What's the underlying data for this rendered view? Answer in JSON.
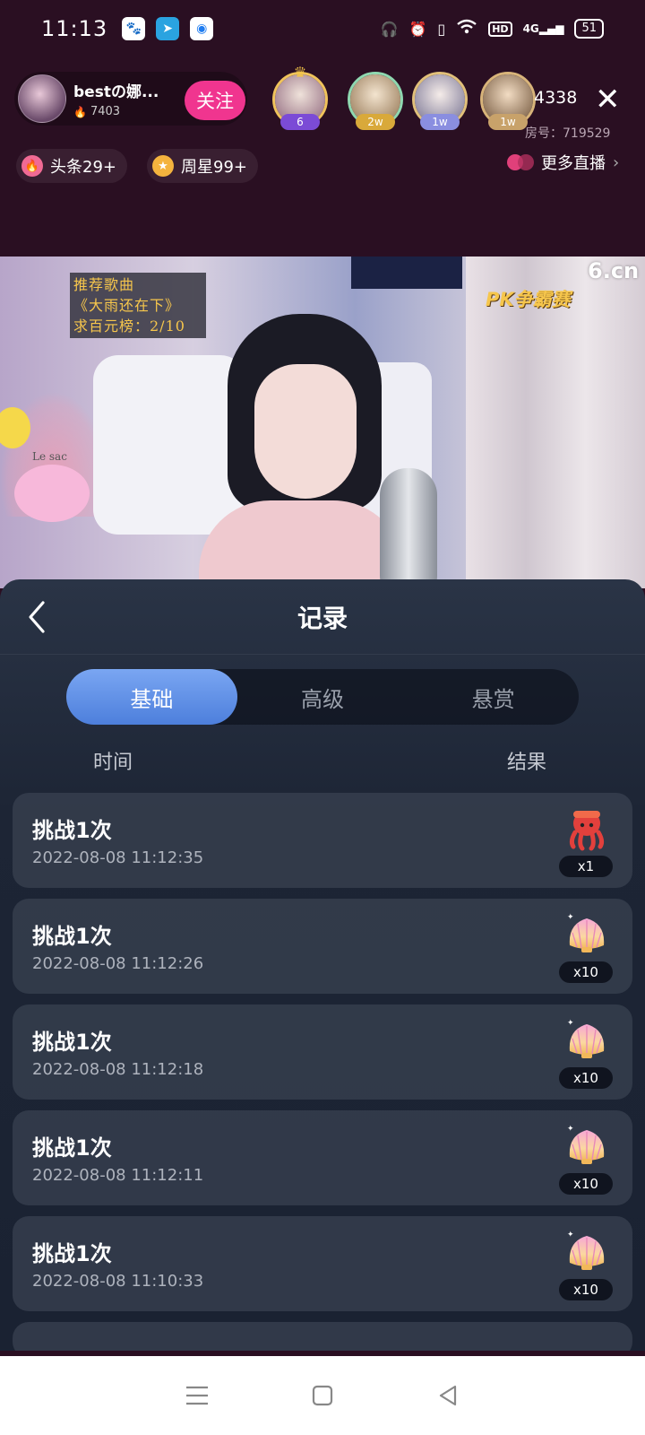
{
  "status_bar": {
    "time": "11:13",
    "hd": "HD",
    "network": "4G",
    "battery": "51"
  },
  "host": {
    "name": "bestの娜...",
    "heat": "7403",
    "follow_label": "关注"
  },
  "top_viewers": [
    {
      "badge": "6",
      "badge_color": "#7b4bd6"
    },
    {
      "badge": "2w",
      "badge_color": "#d9a93a"
    },
    {
      "badge": "1w",
      "badge_color": "#8a8ee0"
    },
    {
      "badge": "1w",
      "badge_color": "#c8a26a"
    }
  ],
  "viewer_count": "4338",
  "room_number": "房号：719529",
  "chips": {
    "headline": "头条29+",
    "weekly_star": "周星99+",
    "more_live": "更多直播"
  },
  "video_overlay": {
    "song_lines": [
      "推荐歌曲",
      "《大雨还在下》",
      "求百元榜：2/10"
    ],
    "brand_logo": "6.cn",
    "pk_logo": "PK争霸赛",
    "lamp_text": "Le sac"
  },
  "panel": {
    "title": "记录",
    "tabs": [
      {
        "label": "基础",
        "active": true
      },
      {
        "label": "高级",
        "active": false
      },
      {
        "label": "悬赏",
        "active": false
      }
    ],
    "columns": {
      "time": "时间",
      "result": "结果"
    },
    "records": [
      {
        "title": "挑战1次",
        "time": "2022-08-08 11:12:35",
        "prize_icon": "octopus-icon",
        "qty": "x1"
      },
      {
        "title": "挑战1次",
        "time": "2022-08-08 11:12:26",
        "prize_icon": "shell-icon",
        "qty": "x10"
      },
      {
        "title": "挑战1次",
        "time": "2022-08-08 11:12:18",
        "prize_icon": "shell-icon",
        "qty": "x10"
      },
      {
        "title": "挑战1次",
        "time": "2022-08-08 11:12:11",
        "prize_icon": "shell-icon",
        "qty": "x10"
      },
      {
        "title": "挑战1次",
        "time": "2022-08-08 11:10:33",
        "prize_icon": "shell-icon",
        "qty": "x10"
      }
    ]
  },
  "colors": {
    "accent_pink": "#f0358f",
    "tab_active": "#5b8de4",
    "panel_bg": "#1d2535"
  }
}
